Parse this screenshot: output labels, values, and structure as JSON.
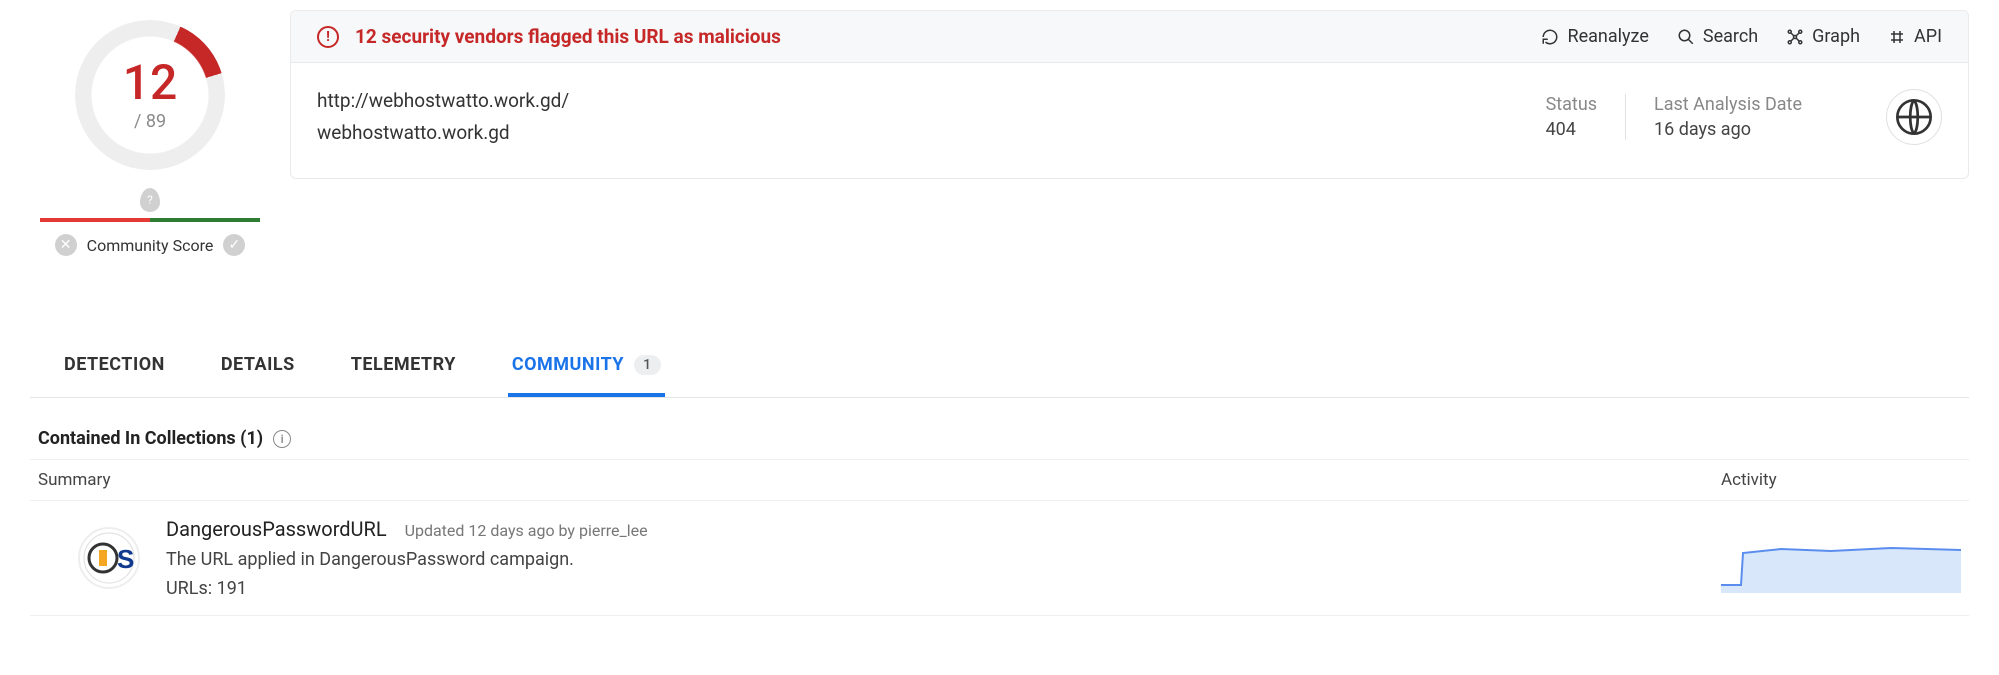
{
  "score": {
    "detected": "12",
    "total": "/ 89"
  },
  "community_score_label": "Community Score",
  "alert": {
    "text": "12 security vendors flagged this URL as malicious"
  },
  "actions": {
    "reanalyze": "Reanalyze",
    "search": "Search",
    "graph": "Graph",
    "api": "API"
  },
  "url": {
    "full": "http://webhostwatto.work.gd/",
    "domain": "webhostwatto.work.gd"
  },
  "status": {
    "label": "Status",
    "value": "404"
  },
  "last_analysis": {
    "label": "Last Analysis Date",
    "value": "16 days ago"
  },
  "tabs": {
    "detection": "DETECTION",
    "details": "DETAILS",
    "telemetry": "TELEMETRY",
    "community": "COMMUNITY",
    "community_count": "1"
  },
  "section": {
    "title": "Contained In Collections  (1)",
    "col_summary": "Summary",
    "col_activity": "Activity"
  },
  "collection": {
    "title": "DangerousPasswordURL",
    "updated": "Updated 12 days ago by pierre_lee",
    "desc": "The URL applied in DangerousPassword campaign.",
    "count": "URLs: 191"
  }
}
